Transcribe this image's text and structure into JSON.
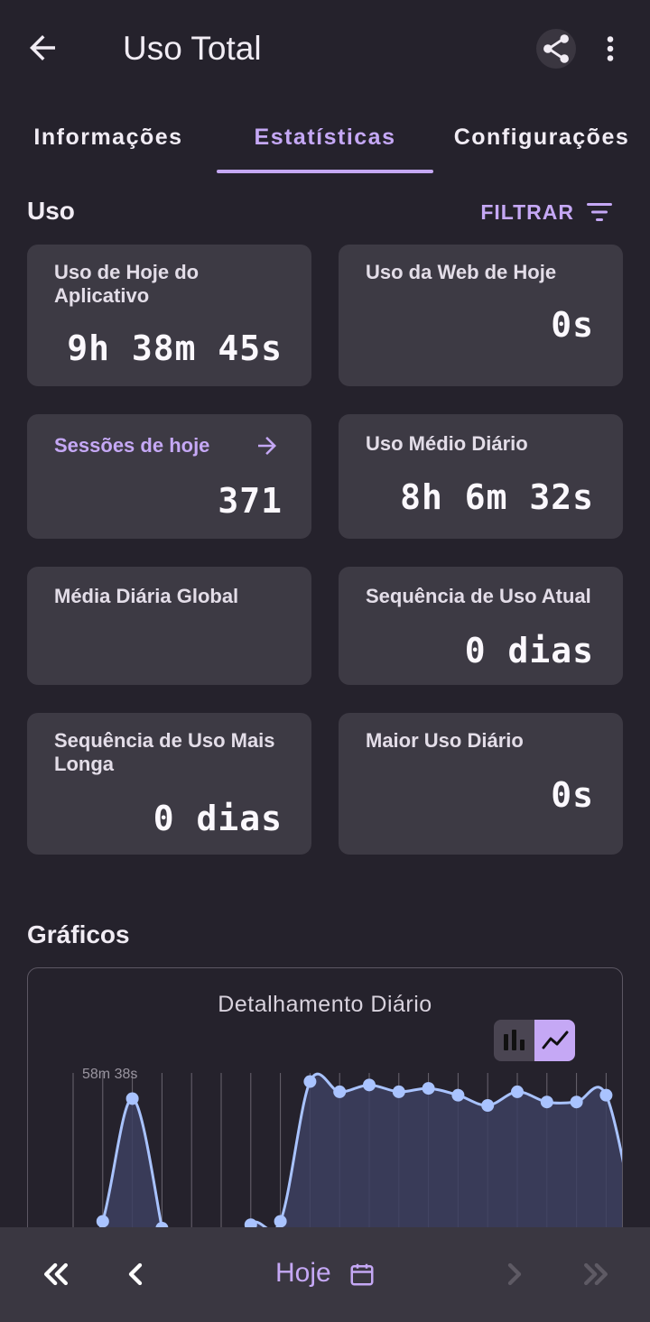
{
  "appbar": {
    "title": "Uso Total"
  },
  "tabs": [
    {
      "label": "Informações"
    },
    {
      "label": "Estatísticas"
    },
    {
      "label": "Configurações"
    }
  ],
  "usage": {
    "section_title": "Uso",
    "filter_label": "FILTRAR",
    "cards": {
      "today_app": {
        "label": "Uso de Hoje do Aplicativo",
        "value": "9h 38m 45s"
      },
      "today_web": {
        "label": "Uso da Web de Hoje",
        "value": "0s"
      },
      "sessions": {
        "label": "Sessões de hoje",
        "value": "371"
      },
      "avg_daily": {
        "label": "Uso Médio Diário",
        "value": "8h 6m 32s"
      },
      "global_avg": {
        "label": "Média Diária Global",
        "value": ""
      },
      "current_streak": {
        "label": "Sequência de Uso Atual",
        "value": "0 dias"
      },
      "longest_streak": {
        "label": "Sequência de Uso Mais Longa",
        "value": "0 dias"
      },
      "max_daily": {
        "label": "Maior Uso Diário",
        "value": "0s"
      }
    }
  },
  "charts": {
    "section_title": "Gráficos",
    "card_title": "Detalhamento Diário",
    "toggle": {
      "bar_icon": "bar-chart-icon",
      "line_icon": "line-chart-icon",
      "selected": "line"
    }
  },
  "chart_data": {
    "type": "area",
    "title": "Detalhamento Diário",
    "y_tick_label": "58m 38s",
    "series": [
      {
        "values": [
          null,
          2,
          38,
          0,
          null,
          null,
          1,
          2,
          43,
          40,
          42,
          40,
          41,
          39,
          36,
          40,
          37,
          37,
          39,
          0
        ]
      }
    ],
    "colors": {
      "line": "#a9c3ff",
      "fill": "#3d4060"
    }
  },
  "bottombar": {
    "date_label": "Hoje"
  }
}
